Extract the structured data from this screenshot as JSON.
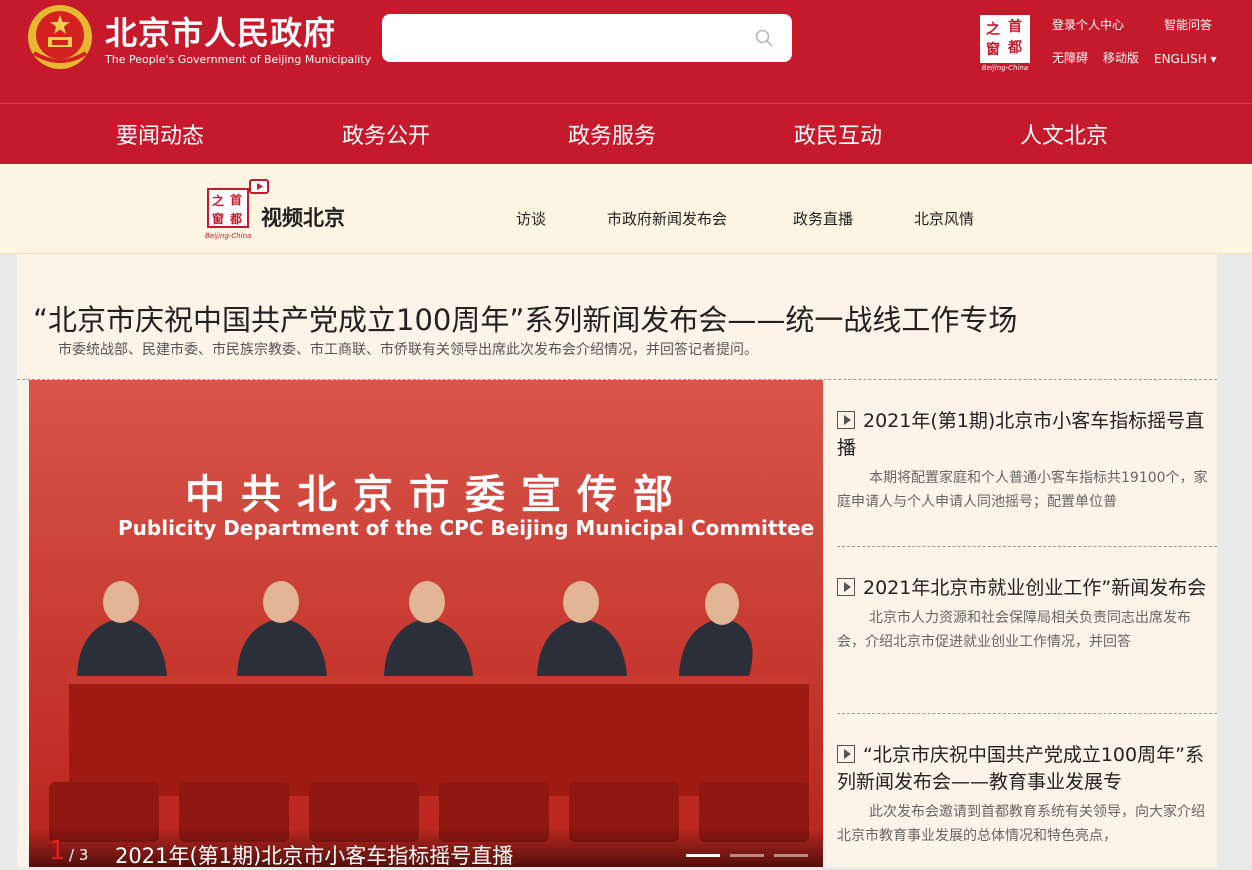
{
  "header": {
    "site_title": "北京市人民政府",
    "site_subtitle": "The People's Government of Beijing Municipality",
    "search_placeholder": "",
    "brand": {
      "chars": [
        "之",
        "首",
        "窗",
        "都"
      ],
      "text": "Beijing-China"
    },
    "links": {
      "login": "登录个人中心",
      "qa": "智能问答",
      "accessibility": "无障碍",
      "mobile": "移动版",
      "english": "ENGLISH ▾"
    }
  },
  "nav": [
    "要闻动态",
    "政务公开",
    "政务服务",
    "政民互动",
    "人文北京"
  ],
  "video_bar": {
    "logo_text": "视频北京",
    "logo_sub": "Beijing-China",
    "items": [
      "访谈",
      "市政府新闻发布会",
      "政务直播",
      "北京风情"
    ]
  },
  "feature": {
    "title": "“北京市庆祝中国共产党成立100周年”系列新闻发布会——统一战线工作专场",
    "desc": "市委统战部、民建市委、市民族宗教委、市工商联、市侨联有关领导出席此次发布会介绍情况，并回答记者提问。"
  },
  "slider": {
    "backdrop_cn": "中共北京市委宣传部",
    "backdrop_en": "Publicity Department of the CPC Beijing Municipal Committee",
    "current": "1",
    "total": "/ 3",
    "caption": "2021年(第1期)北京市小客车指标摇号直播"
  },
  "news": [
    {
      "title": "2021年(第1期)北京市小客车指标摇号直播",
      "desc": "本期将配置家庭和个人普通小客车指标共19100个，家庭申请人与个人申请人同池摇号；配置单位普"
    },
    {
      "title": "2021年北京市就业创业工作”新闻发布会",
      "desc": "北京市人力资源和社会保障局相关负责同志出席发布会，介绍北京市促进就业创业工作情况，并回答"
    },
    {
      "title": "“北京市庆祝中国共产党成立100周年”系列新闻发布会——教育事业发展专",
      "desc": "此次发布会邀请到首都教育系统有关领导，向大家介绍北京市教育事业发展的总体情况和特色亮点，"
    }
  ],
  "colors": {
    "brand_red": "#c41a2b",
    "subbar_bg": "#fdf5e2",
    "main_bg": "#fdf3e8"
  }
}
